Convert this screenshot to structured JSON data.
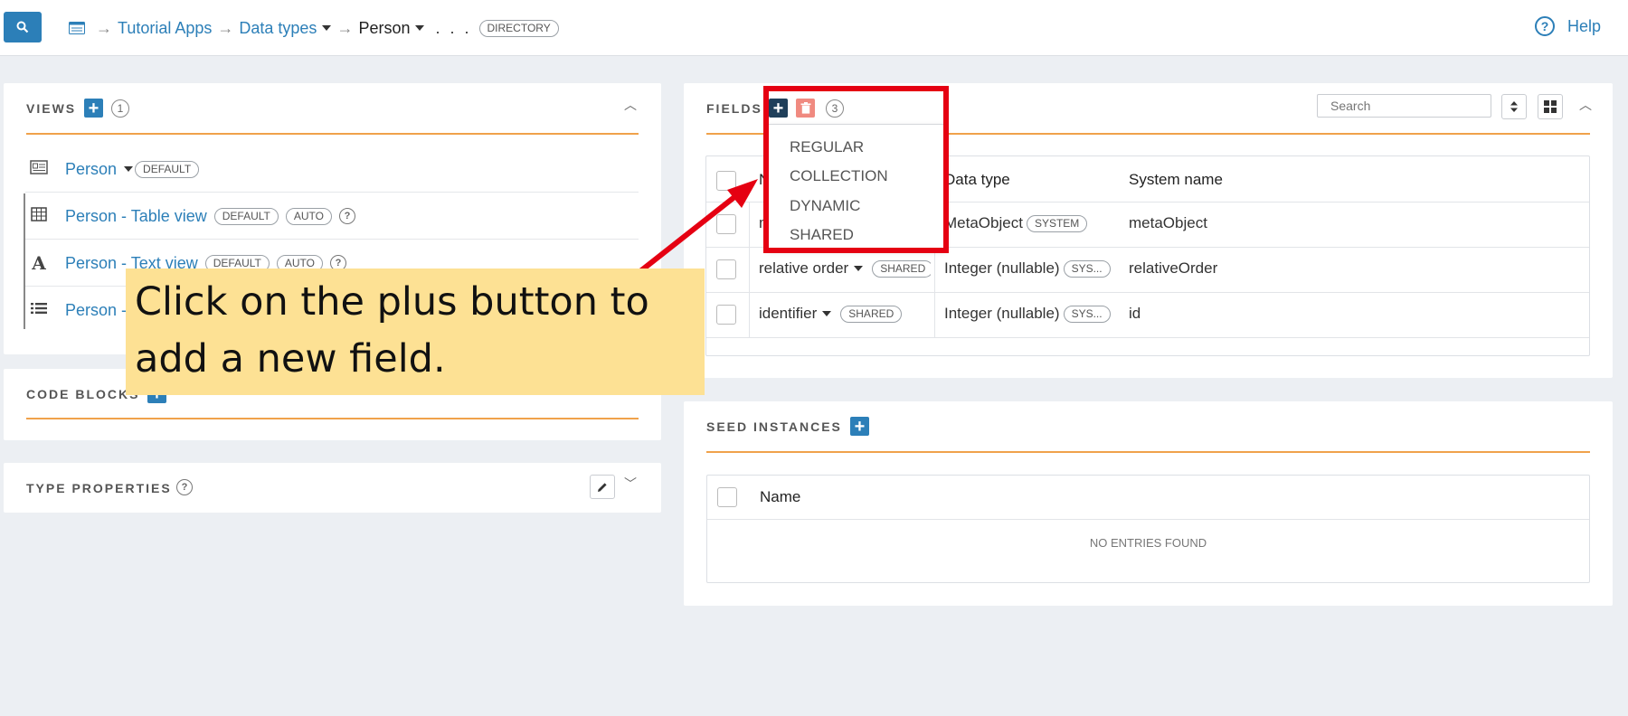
{
  "breadcrumb": {
    "items": [
      "Tutorial Apps",
      "Data types",
      "Person"
    ],
    "ellipsis": ". . .",
    "tag": "DIRECTORY"
  },
  "help_label": "Help",
  "views": {
    "title": "VIEWS",
    "count": "1",
    "items": [
      {
        "label": "Person",
        "tags": [
          "DEFAULT"
        ],
        "icon": "form-icon"
      },
      {
        "label": "Person - Table view",
        "tags": [
          "DEFAULT",
          "AUTO"
        ],
        "icon": "table-icon"
      },
      {
        "label": "Person - Text view",
        "tags": [
          "DEFAULT",
          "AUTO"
        ],
        "icon": "text-icon"
      },
      {
        "label": "Person - l",
        "tags": [],
        "icon": "list-icon"
      }
    ]
  },
  "code_blocks": {
    "title": "CODE BLOCKS"
  },
  "type_properties": {
    "title": "TYPE PROPERTIES"
  },
  "fields": {
    "title": "FIELDS",
    "count": "3",
    "search_placeholder": "Search",
    "columns": [
      "N",
      "Data type",
      "System name"
    ],
    "rows": [
      {
        "name": "m",
        "tag": "",
        "data_type": "MetaObject",
        "type_tag": "SYSTEM",
        "system_name": "metaObject"
      },
      {
        "name": "relative order",
        "tag": "SHARED",
        "data_type": "Integer (nullable)",
        "type_tag": "SYS...",
        "system_name": "relativeOrder"
      },
      {
        "name": "identifier",
        "tag": "SHARED",
        "data_type": "Integer (nullable)",
        "type_tag": "SYS...",
        "system_name": "id"
      }
    ],
    "add_menu": [
      "REGULAR",
      "COLLECTION",
      "DYNAMIC",
      "SHARED"
    ]
  },
  "seed_instances": {
    "title": "SEED INSTANCES",
    "column": "Name",
    "empty_text": "NO ENTRIES FOUND"
  },
  "annotation": {
    "text": "Click on the plus button to add a new field.",
    "box_color": "#e50012",
    "callout_color": "#fde194"
  },
  "colors": {
    "accent": "#2c7fb8",
    "divider": "#f0a24b",
    "delete": "#f08a80",
    "plus_dark": "#1f3f5a"
  }
}
